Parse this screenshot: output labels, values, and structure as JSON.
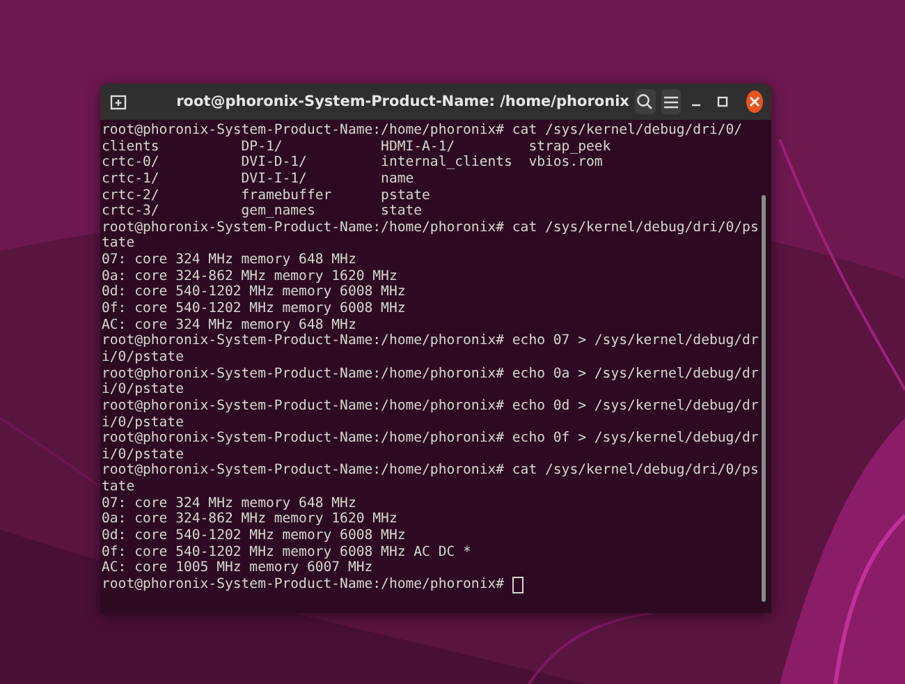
{
  "window": {
    "title": "root@phoronix-System-Product-Name: /home/phoronix"
  },
  "terminal": {
    "cursor": true,
    "lines": [
      "root@phoronix-System-Product-Name:/home/phoronix# cat /sys/kernel/debug/dri/0/",
      "clients          DP-1/            HDMI-A-1/         strap_peek",
      "crtc-0/          DVI-D-1/         internal_clients  vbios.rom",
      "crtc-1/          DVI-I-1/         name",
      "crtc-2/          framebuffer      pstate",
      "crtc-3/          gem_names        state",
      "root@phoronix-System-Product-Name:/home/phoronix# cat /sys/kernel/debug/dri/0/ps",
      "tate",
      "07: core 324 MHz memory 648 MHz",
      "0a: core 324-862 MHz memory 1620 MHz",
      "0d: core 540-1202 MHz memory 6008 MHz",
      "0f: core 540-1202 MHz memory 6008 MHz",
      "AC: core 324 MHz memory 648 MHz",
      "root@phoronix-System-Product-Name:/home/phoronix# echo 07 > /sys/kernel/debug/dr",
      "i/0/pstate",
      "root@phoronix-System-Product-Name:/home/phoronix# echo 0a > /sys/kernel/debug/dr",
      "i/0/pstate",
      "root@phoronix-System-Product-Name:/home/phoronix# echo 0d > /sys/kernel/debug/dr",
      "i/0/pstate",
      "root@phoronix-System-Product-Name:/home/phoronix# echo 0f > /sys/kernel/debug/dr",
      "i/0/pstate",
      "root@phoronix-System-Product-Name:/home/phoronix# cat /sys/kernel/debug/dri/0/ps",
      "tate",
      "07: core 324 MHz memory 648 MHz",
      "0a: core 324-862 MHz memory 1620 MHz",
      "0d: core 540-1202 MHz memory 6008 MHz",
      "0f: core 540-1202 MHz memory 6008 MHz AC DC *",
      "AC: core 1005 MHz memory 6007 MHz",
      "root@phoronix-System-Product-Name:/home/phoronix#"
    ]
  }
}
